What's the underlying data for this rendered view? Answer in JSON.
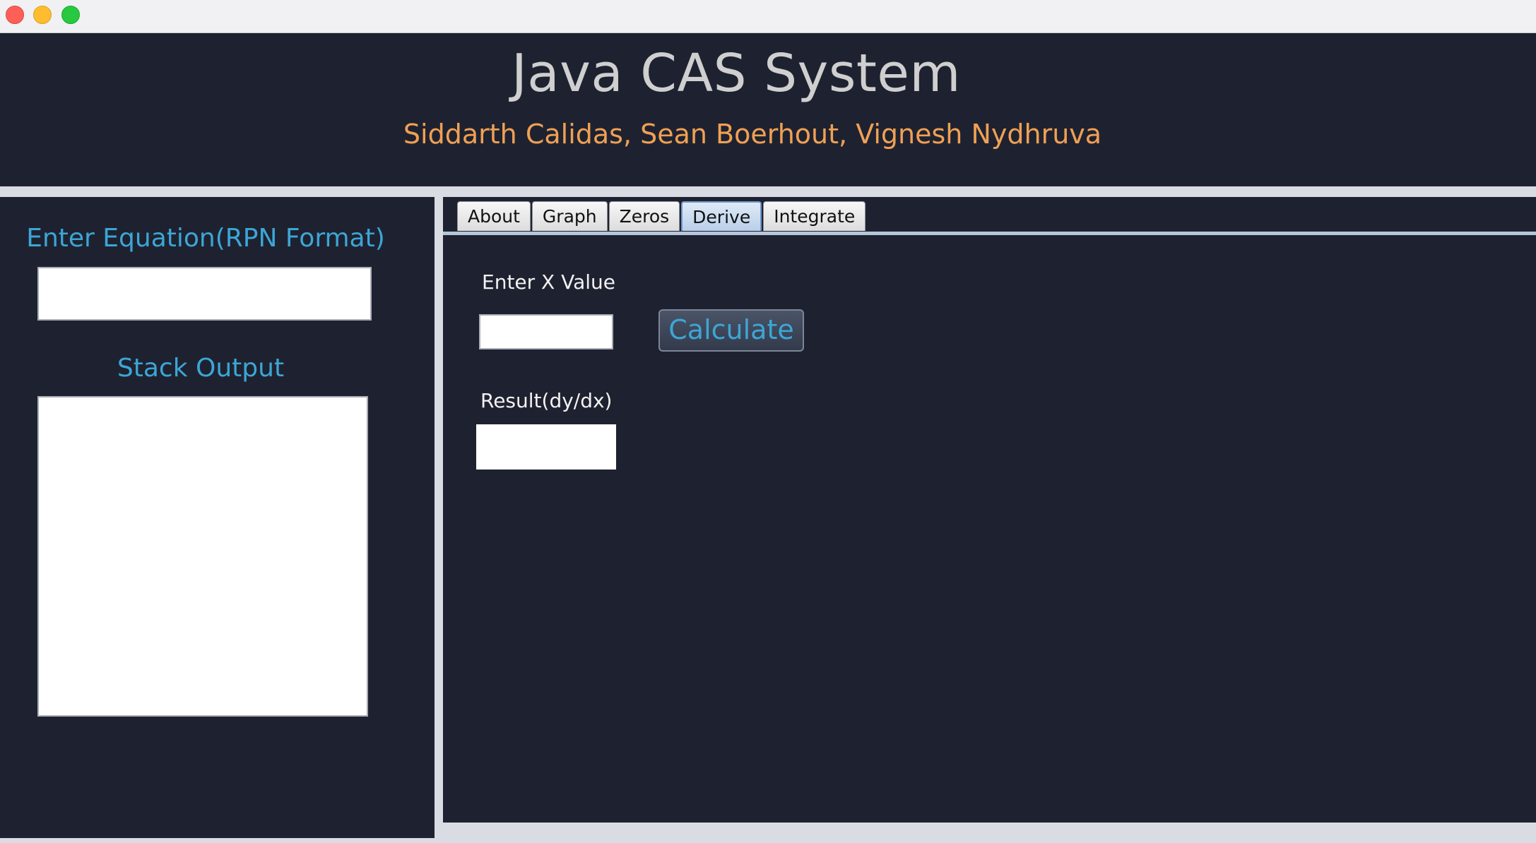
{
  "window": {
    "traffic_lights": [
      "close",
      "minimize",
      "maximize"
    ]
  },
  "header": {
    "title": "Java CAS System",
    "authors": "Siddarth Calidas, Sean Boerhout, Vignesh Nydhruva"
  },
  "left_panel": {
    "equation_label": "Enter Equation(RPN Format)",
    "equation_value": "",
    "stack_label": "Stack Output",
    "stack_value": ""
  },
  "tabs": [
    {
      "label": "About",
      "active": false
    },
    {
      "label": "Graph",
      "active": false
    },
    {
      "label": "Zeros",
      "active": false
    },
    {
      "label": "Derive",
      "active": true
    },
    {
      "label": "Integrate",
      "active": false
    }
  ],
  "derive": {
    "x_label": "Enter X Value",
    "x_value": "",
    "calculate_label": "Calculate",
    "result_label": "Result(dy/dx)",
    "result_value": ""
  },
  "colors": {
    "panel_bg": "#1e2230",
    "accent_blue": "#3ca6d6",
    "authors_orange": "#f0a054",
    "title_gray": "#cfcfcf"
  }
}
